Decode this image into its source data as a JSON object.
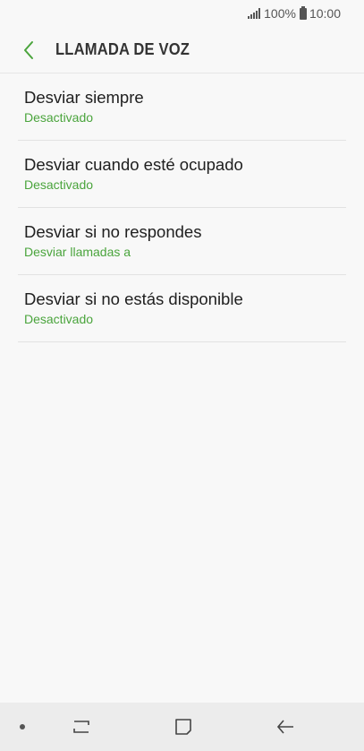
{
  "status_bar": {
    "battery": "100%",
    "time": "10:00"
  },
  "header": {
    "title": "LLAMADA DE VOZ",
    "back_icon": "chevron-left-icon"
  },
  "list": [
    {
      "title": "Desviar siempre",
      "subtitle": "Desactivado"
    },
    {
      "title": "Desviar cuando esté ocupado",
      "subtitle": "Desactivado"
    },
    {
      "title": "Desviar si no respondes",
      "subtitle": "Desviar llamadas a"
    },
    {
      "title": "Desviar si no estás disponible",
      "subtitle": "Desactivado"
    }
  ],
  "nav_bar": {
    "icons": [
      "recent-apps-icon",
      "home-icon",
      "back-icon"
    ]
  },
  "colors": {
    "accent": "#4aa43c",
    "background": "#f8f8f8",
    "nav_background": "#ececec"
  }
}
